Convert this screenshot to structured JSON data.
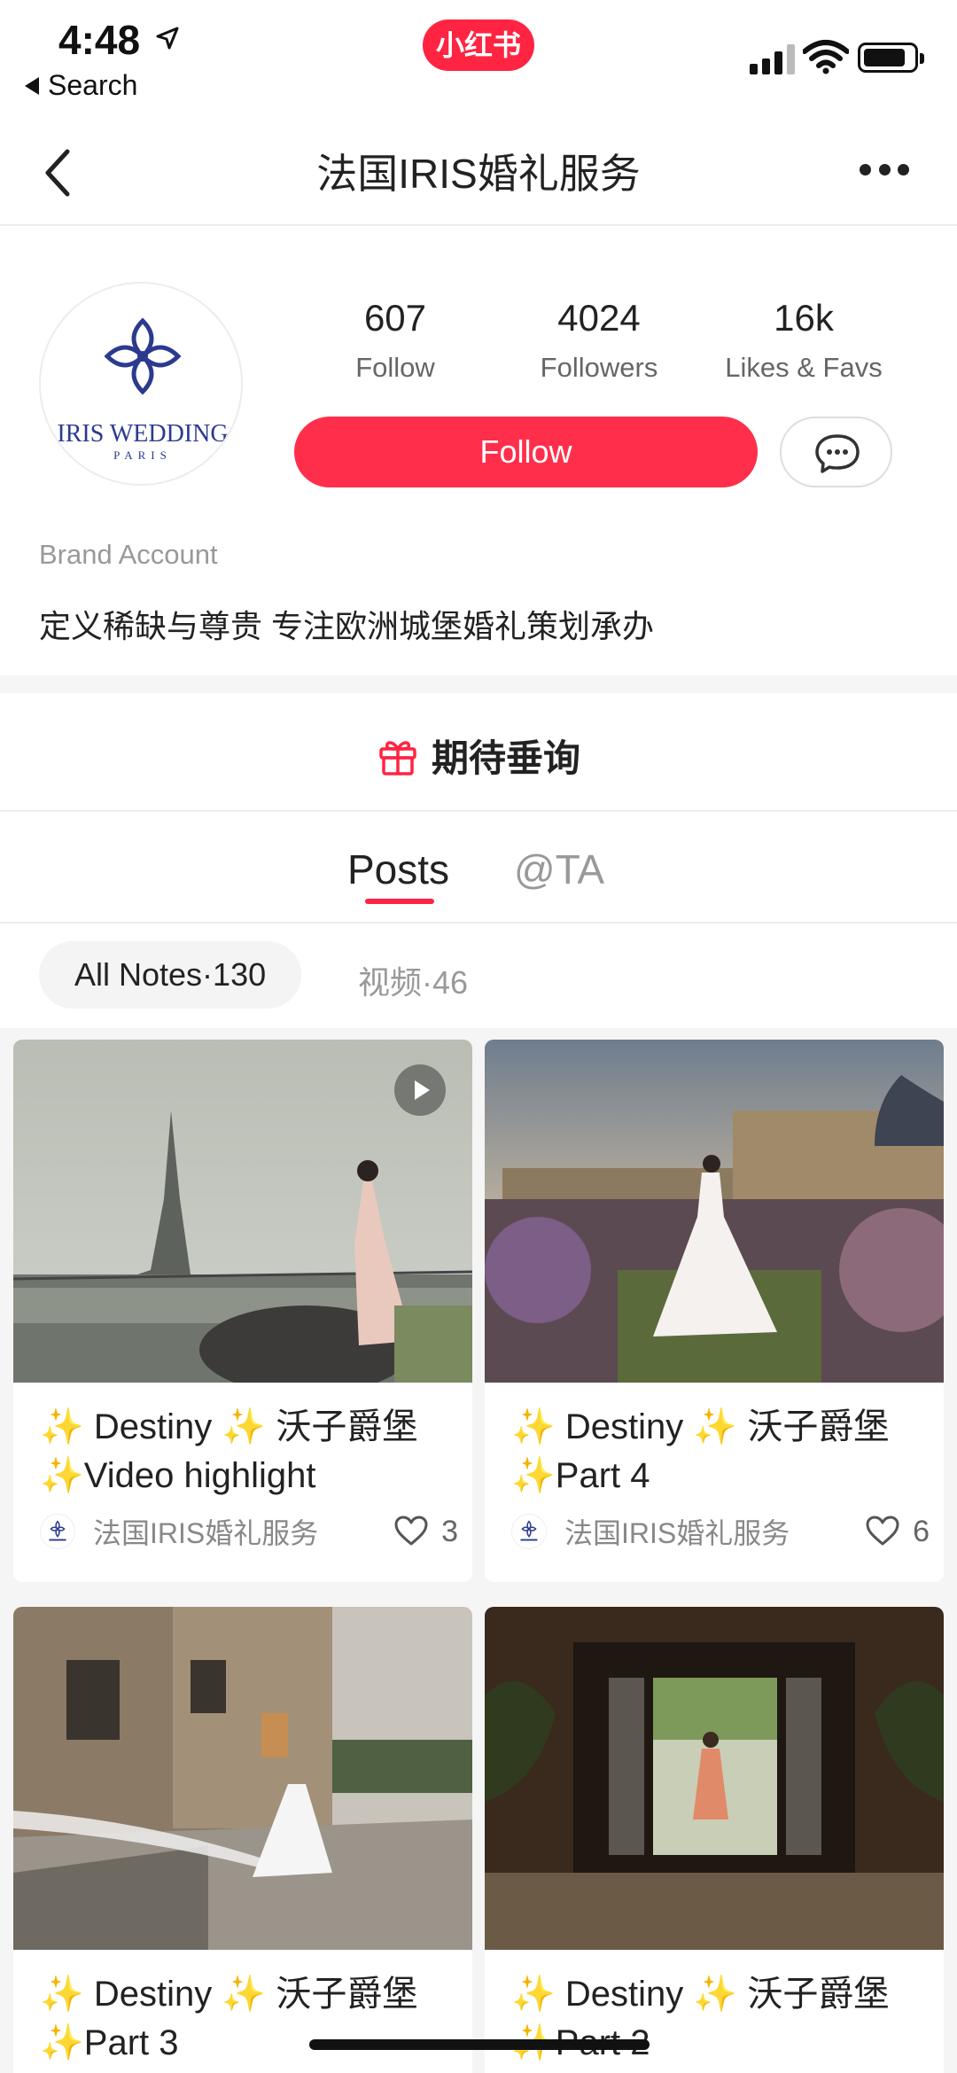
{
  "status_bar": {
    "time": "4:48",
    "back_label": "Search",
    "app_badge": "小红书"
  },
  "nav": {
    "title": "法国IRIS婚礼服务"
  },
  "profile": {
    "avatar_logo_text": "IRIS WEDDING",
    "avatar_logo_sub": "PARIS",
    "stats": [
      {
        "value": "607",
        "label": "Follow"
      },
      {
        "value": "4024",
        "label": "Followers"
      },
      {
        "value": "16k",
        "label": "Likes & Favs"
      }
    ],
    "follow_label": "Follow",
    "brand_label": "Brand Account",
    "bio": "定义稀缺与尊贵 专注欧洲城堡婚礼策划承办"
  },
  "promo": {
    "label": "期待垂询"
  },
  "tabs": {
    "posts": "Posts",
    "at": "@TA"
  },
  "filters": {
    "all_notes": "All Notes·130",
    "videos": "视频·46"
  },
  "colors": {
    "brand_red": "#ff2442",
    "follow_red": "#ff2f4b",
    "logo_blue": "#2b3a8f"
  },
  "cards": [
    {
      "title": "✨ Destiny ✨ 沃子爵堡 ✨Video highlight",
      "author": "法国IRIS婚礼服务",
      "likes": "3",
      "is_video": true
    },
    {
      "title": "✨ Destiny ✨ 沃子爵堡 ✨Part 4",
      "author": "法国IRIS婚礼服务",
      "likes": "6",
      "is_video": false
    },
    {
      "title": "✨ Destiny ✨ 沃子爵堡 ✨Part 3",
      "author": "",
      "likes": "",
      "is_video": false
    },
    {
      "title": "✨ Destiny ✨ 沃子爵堡 ✨Part 2",
      "author": "",
      "likes": "",
      "is_video": false
    }
  ]
}
